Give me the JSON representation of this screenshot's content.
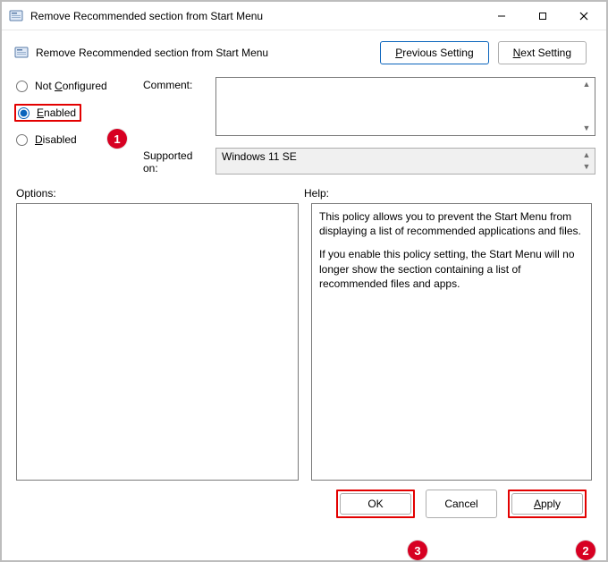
{
  "window": {
    "title": "Remove Recommended section from Start Menu"
  },
  "header": {
    "title": "Remove Recommended section from Start Menu"
  },
  "nav": {
    "previous": "Previous Setting",
    "next": "Next Setting"
  },
  "settings": {
    "not_configured": "Not Configured",
    "enabled": "Enabled",
    "disabled": "Disabled",
    "selected": "enabled",
    "comment_label": "Comment:",
    "comment_value": "",
    "supported_label": "Supported on:",
    "supported_value": "Windows 11 SE"
  },
  "sections": {
    "options_label": "Options:",
    "help_label": "Help:",
    "options_text": "",
    "help_p1": "This policy allows you to prevent the Start Menu from displaying a list of recommended applications and files.",
    "help_p2": "If you enable this policy setting, the Start Menu will no longer show the section containing a list of recommended files and apps."
  },
  "buttons": {
    "ok": "OK",
    "cancel": "Cancel",
    "apply": "Apply"
  },
  "callouts": {
    "c1": "1",
    "c2": "2",
    "c3": "3"
  }
}
